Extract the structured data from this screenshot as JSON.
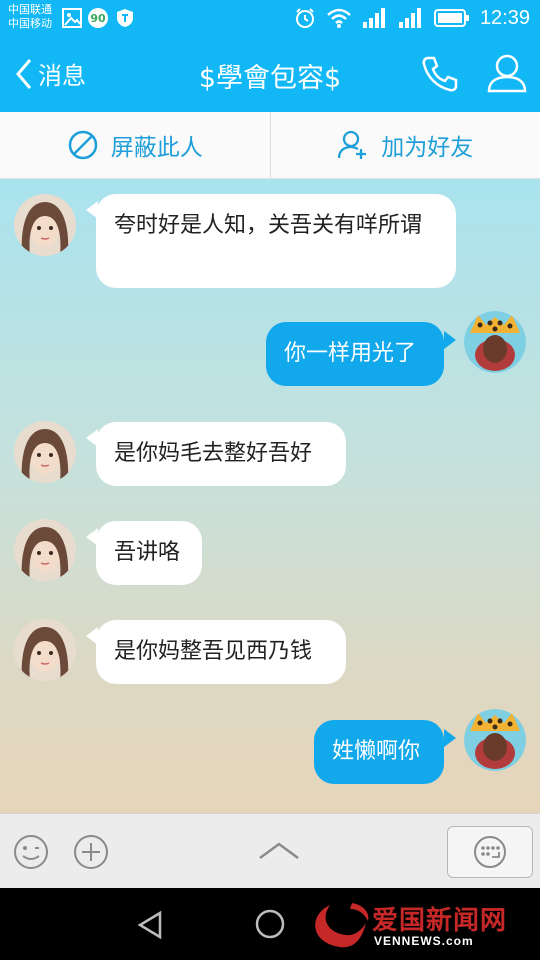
{
  "status_bar": {
    "carrier_1": "中国联通",
    "carrier_2": "中国移动",
    "badge": "90",
    "time": "12:39"
  },
  "nav": {
    "back_label": "消息",
    "title": "$學會包容$"
  },
  "actions": {
    "block_label": "屏蔽此人",
    "add_friend_label": "加为好友"
  },
  "messages": [
    {
      "side": "in",
      "text": "夸时好是人知，关吾关有咩所谓"
    },
    {
      "side": "out",
      "text": "你一样用光了"
    },
    {
      "side": "in",
      "text": "是你妈毛去整好吾好"
    },
    {
      "side": "in",
      "text": "吾讲咯"
    },
    {
      "side": "in",
      "text": "是你妈整吾见西乃钱"
    },
    {
      "side": "out",
      "text": "姓懒啊你"
    }
  ],
  "watermark": {
    "title": "爱国新闻网",
    "domain": "VENNEWS.com"
  },
  "colors": {
    "primary": "#12b7f5",
    "bubble_out": "#12a8ec",
    "bubble_in": "#ffffff",
    "action_text": "#1e9fd9"
  }
}
